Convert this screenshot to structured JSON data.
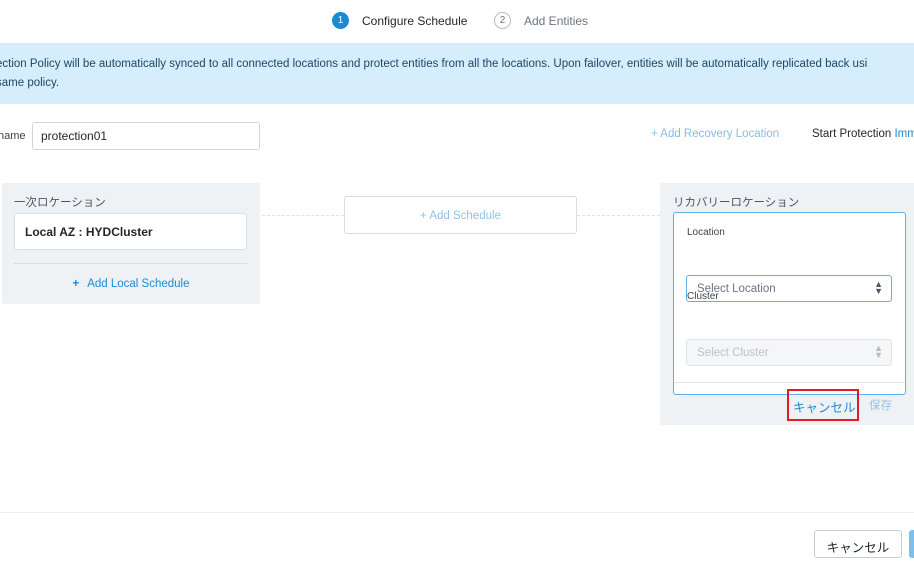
{
  "steps": [
    {
      "num": "1",
      "label": "Configure Schedule",
      "active": true
    },
    {
      "num": "2",
      "label": "Add Entities",
      "active": false
    }
  ],
  "banner": {
    "line1": "ection Policy will be automatically synced to all connected locations and protect entities from all the locations. Upon failover, entities will be automatically replicated back usi",
    "line2": "same policy."
  },
  "name_field": {
    "label": "name",
    "value": "protection01"
  },
  "header_actions": {
    "add_recovery_location": "+ Add Recovery Location",
    "start_protection_label": "Start Protection",
    "start_protection_value": "Imm"
  },
  "primary_location": {
    "title": "一次ロケーション",
    "local_az": "Local AZ : HYDCluster",
    "add_local_schedule": "Add Local Schedule"
  },
  "add_schedule": "+ Add Schedule",
  "recovery_location": {
    "title": "リカバリーロケーション",
    "location_label": "Location",
    "location_placeholder": "Select Location",
    "cluster_label": "Cluster",
    "cluster_placeholder": "Select Cluster",
    "cancel_label": "キャンセル",
    "save_label": "保存"
  },
  "footer": {
    "cancel_label": "キャンセル"
  },
  "colors": {
    "accent": "#1b8ad6",
    "banner_bg": "#d6eefb",
    "highlight": "#e11c24"
  }
}
